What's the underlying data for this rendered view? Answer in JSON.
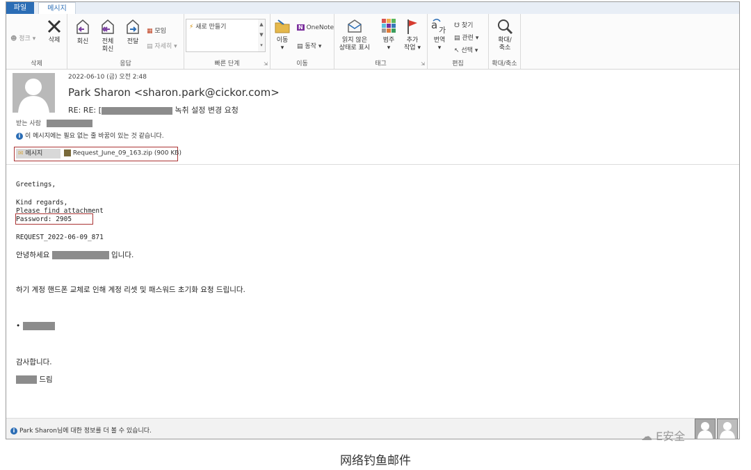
{
  "tabs": {
    "file": "파일",
    "message": "메시지"
  },
  "ribbon": {
    "delete_group": {
      "ignore": "정크",
      "delete": "삭제",
      "label": "삭제"
    },
    "respond_group": {
      "reply": "회신",
      "reply_all_1": "전체",
      "reply_all_2": "회신",
      "forward": "전달",
      "meeting": "모임",
      "more": "자세히",
      "label": "응답"
    },
    "quick_steps_group": {
      "new": "새로 만들기",
      "label": "빠른 단계"
    },
    "move_group": {
      "move": "이동",
      "onenote": "OneNote",
      "actions": "동작",
      "label": "이동"
    },
    "tags_group": {
      "unread_1": "읽지 않은",
      "unread_2": "상태로 표시",
      "categorize": "범주",
      "followup_1": "추가",
      "followup_2": "작업",
      "label": "태그"
    },
    "editing_group": {
      "translate": "번역",
      "find": "찾기",
      "related": "관련",
      "select": "선택",
      "label": "편집"
    },
    "zoom_group": {
      "zoom_1": "확대/",
      "zoom_2": "축소",
      "label": "확대/축소"
    }
  },
  "header": {
    "date": "2022-06-10 (금) 오전 2:48",
    "sender": "Park Sharon <sharon.park@cickor.com>",
    "subject_prefix": "RE: RE: [",
    "subject_suffix": "녹취 설정 변경 요청",
    "to_label": "받는 사람",
    "info": "이 메시지에는 필요 없는 줄 바꿈이 있는 것 같습니다."
  },
  "attachments": {
    "message": "메시지",
    "file": "Request_June_09_163.zip (900 KB)"
  },
  "body": {
    "greeting": "Greetings,",
    "regards": "Kind regards,",
    "find": "Please find attachment",
    "password": "Password: 2905",
    "request": "REQUEST_2022-06-09_871",
    "hello_prefix": "안녕하세요",
    "hello_suffix": "입니다.",
    "request_text": "하기 계정 핸드폰 교체로 인해 계정 리셋 및 패스워드 초기화 요청 드립니다.",
    "bullet": "•",
    "thanks": "감사합니다.",
    "closing": "드림"
  },
  "footer": {
    "text": "Park Sharon님에 대한 정보를 더 볼 수 있습니다."
  },
  "watermark": "E安全",
  "caption": "网络钓鱼邮件"
}
